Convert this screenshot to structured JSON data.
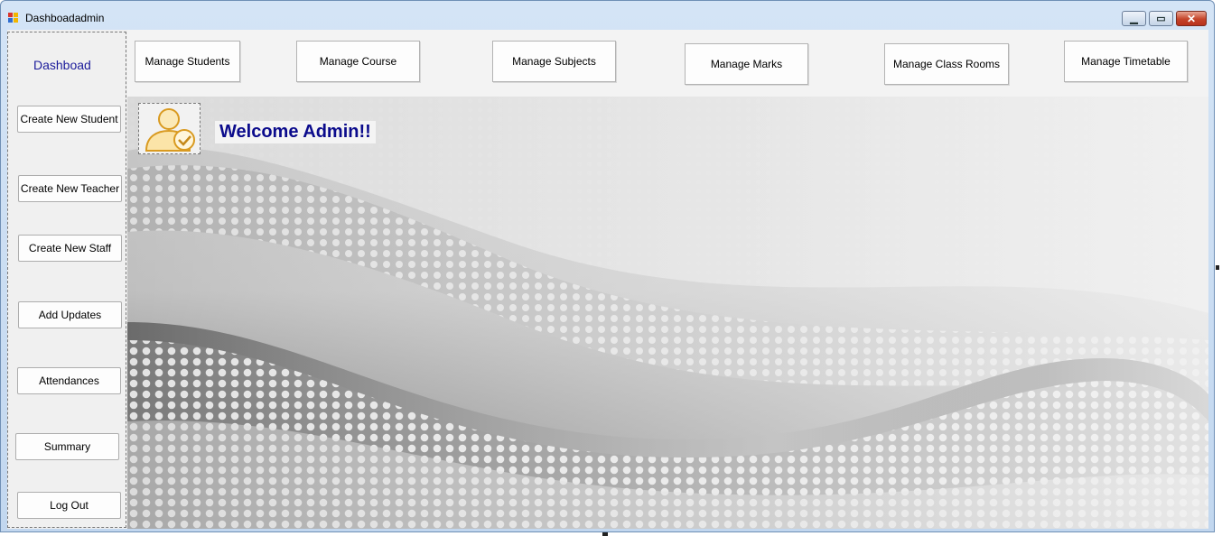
{
  "window": {
    "title": "Dashboadadmin",
    "caption": {
      "minimize": "▁",
      "maximize": "▭",
      "close": "✕"
    }
  },
  "sidebar": {
    "brand": "Dashboad",
    "buttons": [
      "Create New Student",
      "Create New Teacher",
      "Create New Staff",
      "Add Updates",
      "Attendances",
      "Summary",
      "Log Out"
    ]
  },
  "topbar": {
    "buttons": [
      "Manage Students",
      "Manage Course",
      "Manage Subjects",
      "Manage Marks",
      "Manage Class Rooms",
      "Manage Timetable"
    ]
  },
  "main": {
    "welcome": "Welcome Admin!!",
    "avatar_icon": "admin-user-icon"
  },
  "colors": {
    "title_bar": "#c9dcf2",
    "close_button": "#c5442a",
    "brand_text": "#1a1a9a",
    "welcome_text": "#0b0b8c",
    "avatar_accent": "#e8b13a"
  }
}
